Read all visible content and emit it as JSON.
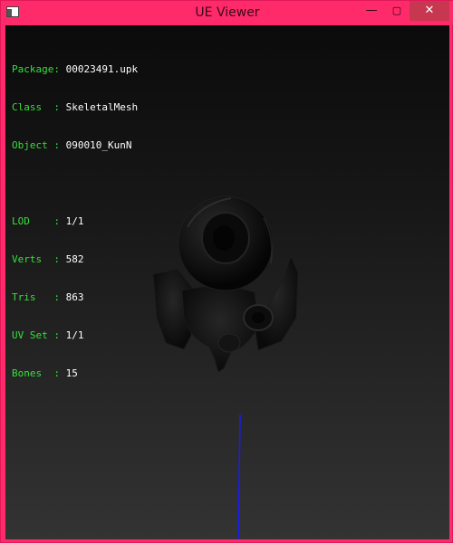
{
  "window": {
    "title": "UE Viewer",
    "minimize_glyph": "—",
    "maximize_glyph": "▢",
    "close_glyph": "✕"
  },
  "info": {
    "header": [
      {
        "label": "Package: ",
        "value": "00023491.upk"
      },
      {
        "label": "Class  : ",
        "value": "SkeletalMesh"
      },
      {
        "label": "Object : ",
        "value": "090010_KunN"
      }
    ],
    "stats": [
      {
        "label": "LOD    : ",
        "value": "1/1"
      },
      {
        "label": "Verts  : ",
        "value": "582"
      },
      {
        "label": "Tris   : ",
        "value": "863"
      },
      {
        "label": "UV Set : ",
        "value": "1/1"
      },
      {
        "label": "Bones  : ",
        "value": "15"
      }
    ]
  },
  "colors": {
    "titlebar": "#ff2a6a",
    "label_text": "#35e03a",
    "value_text": "#ffffff",
    "axis_line": "#1a1aff"
  }
}
